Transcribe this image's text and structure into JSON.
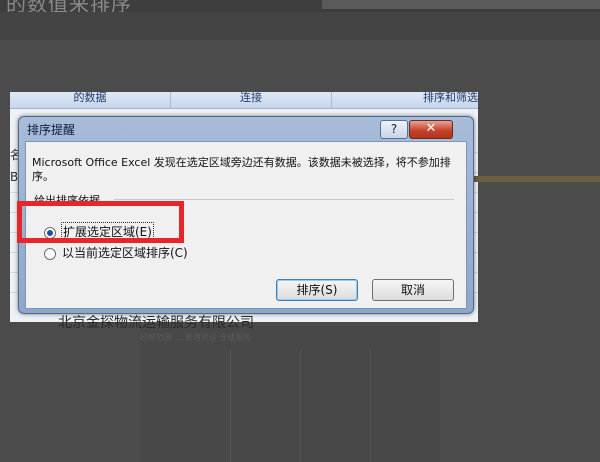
{
  "background": {
    "title_fragment": "的数值来排序",
    "company_text": "北京金探物流运输服务有限公司",
    "small_text": "经营范围 ... 普通货运 仓储服务"
  },
  "excel": {
    "ribbon_groups": [
      "的数据",
      "连接",
      "排序和筛选"
    ],
    "side_letters": [
      "名",
      "B"
    ]
  },
  "dialog": {
    "title": "排序提醒",
    "help_label": "?",
    "close_label": "✕",
    "message": "Microsoft Office Excel 发现在选定区域旁边还有数据。该数据未被选择，将不参加排序。",
    "group_label": "给出排序依据",
    "options": [
      {
        "label": "扩展选定区域(E)",
        "checked": true
      },
      {
        "label": "以当前选定区域排序(C)",
        "checked": false
      }
    ],
    "sort_button": "排序(S)",
    "cancel_button": "取消"
  },
  "colors": {
    "highlight": "#e8262a",
    "close_button": "#c5452c"
  }
}
